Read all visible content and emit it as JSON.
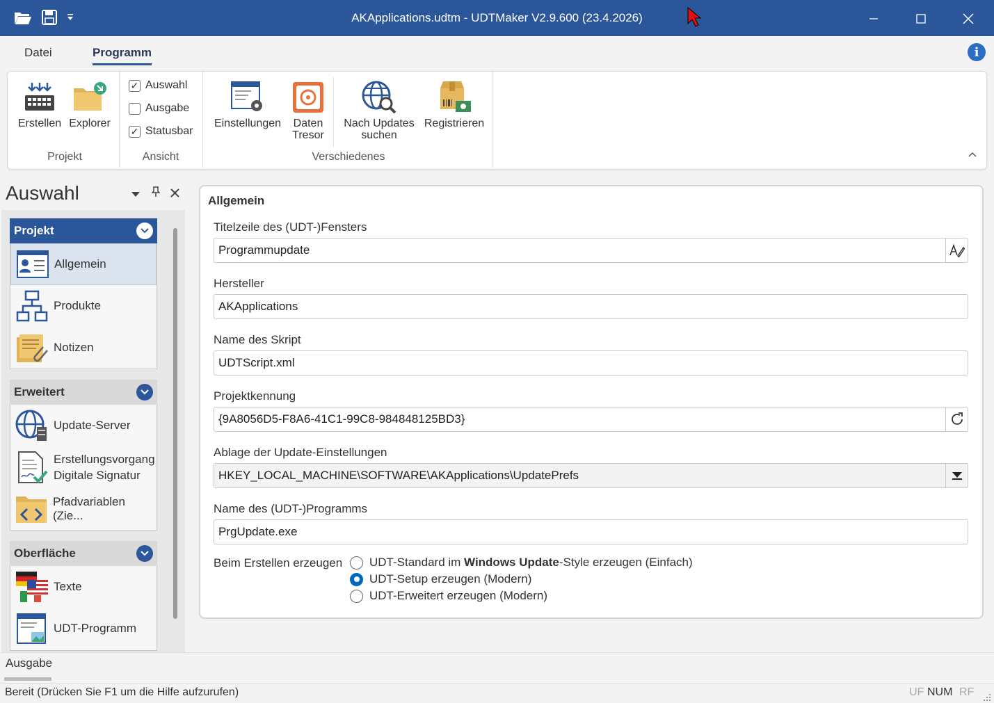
{
  "window": {
    "title": "AKApplications.udtm - UDTMaker V2.9.600 (23.4.2026)",
    "accent": "#2b579a"
  },
  "quick_access": [
    "open-folder-icon",
    "save-icon",
    "dropdown-icon"
  ],
  "tabs": [
    {
      "label": "Datei",
      "active": false
    },
    {
      "label": "Programm",
      "active": true
    }
  ],
  "ribbon": {
    "projekt": {
      "label": "Projekt",
      "buttons": [
        {
          "label": "Erstellen",
          "icon": "build-icon"
        },
        {
          "label": "Explorer",
          "icon": "folder-explorer-icon"
        }
      ]
    },
    "ansicht": {
      "label": "Ansicht",
      "checkboxes": [
        {
          "label": "Auswahl",
          "checked": true
        },
        {
          "label": "Ausgabe",
          "checked": false
        },
        {
          "label": "Statusbar",
          "checked": true
        }
      ]
    },
    "verschiedenes": {
      "label": "Verschiedenes",
      "buttons": [
        {
          "label": "Einstellungen",
          "icon": "settings-window-icon"
        },
        {
          "label1": "Daten",
          "label2": "Tresor",
          "icon": "safe-icon"
        },
        {
          "label1": "Nach Updates",
          "label2": "suchen",
          "icon": "web-search-icon"
        },
        {
          "label": "Registrieren",
          "icon": "register-icon"
        }
      ]
    }
  },
  "left_pane": {
    "title": "Auswahl",
    "groups": [
      {
        "header": "Projekt",
        "items": [
          {
            "label": "Allgemein",
            "icon": "id-card-icon",
            "selected": true
          },
          {
            "label": "Produkte",
            "icon": "hierarchy-icon"
          },
          {
            "label": "Notizen",
            "icon": "notes-icon"
          }
        ]
      },
      {
        "header": "Erweitert",
        "items": [
          {
            "label": "Update-Server",
            "icon": "globe-server-icon"
          },
          {
            "label1": "Erstellungsvorgang",
            "label2": "Digitale Signatur",
            "icon": "signed-document-icon"
          },
          {
            "label": "Pfadvariablen (Zie...",
            "icon": "folder-code-icon"
          }
        ]
      },
      {
        "header": "Oberfläche",
        "items": [
          {
            "label": "Texte",
            "icon": "flags-icon"
          },
          {
            "label": "UDT-Programm",
            "icon": "program-window-icon"
          }
        ]
      }
    ]
  },
  "main": {
    "section_title": "Allgemein",
    "fields": [
      {
        "label": "Titelzeile des (UDT-)Fensters",
        "value": "Programmupdate",
        "button": "edit-text-icon"
      },
      {
        "label": "Hersteller",
        "value": "AKApplications"
      },
      {
        "label": "Name des Skript",
        "value": "UDTScript.xml"
      },
      {
        "label": "Projektkennung",
        "value": "{9A8056D5-F8A6-41C1-99C8-984848125BD3}",
        "button": "refresh-icon"
      },
      {
        "label": "Ablage der Update-Einstellungen",
        "value": "HKEY_LOCAL_MACHINE\\SOFTWARE\\AKApplications\\UpdatePrefs",
        "button": "dropdown-icon"
      },
      {
        "label": "Name des (UDT-)Programms",
        "value": "PrgUpdate.exe"
      }
    ],
    "radio_group": {
      "label": "Beim Erstellen erzeugen",
      "options": [
        {
          "pre": "UDT-Standard im ",
          "bold1": "Windows Update",
          "post": "-Style erzeugen (Einfach)",
          "checked": false
        },
        {
          "label": "UDT-Setup erzeugen (Modern)",
          "checked": true
        },
        {
          "label": "UDT-Erweitert erzeugen (Modern)",
          "checked": false
        }
      ]
    }
  },
  "output": {
    "label": "Ausgabe"
  },
  "status": {
    "text": "Bereit (Drücken Sie F1 um die Hilfe aufzurufen)",
    "indicators": [
      {
        "label": "UF",
        "active": false
      },
      {
        "label": "NUM",
        "active": true
      },
      {
        "label": "RF",
        "active": false
      }
    ]
  }
}
